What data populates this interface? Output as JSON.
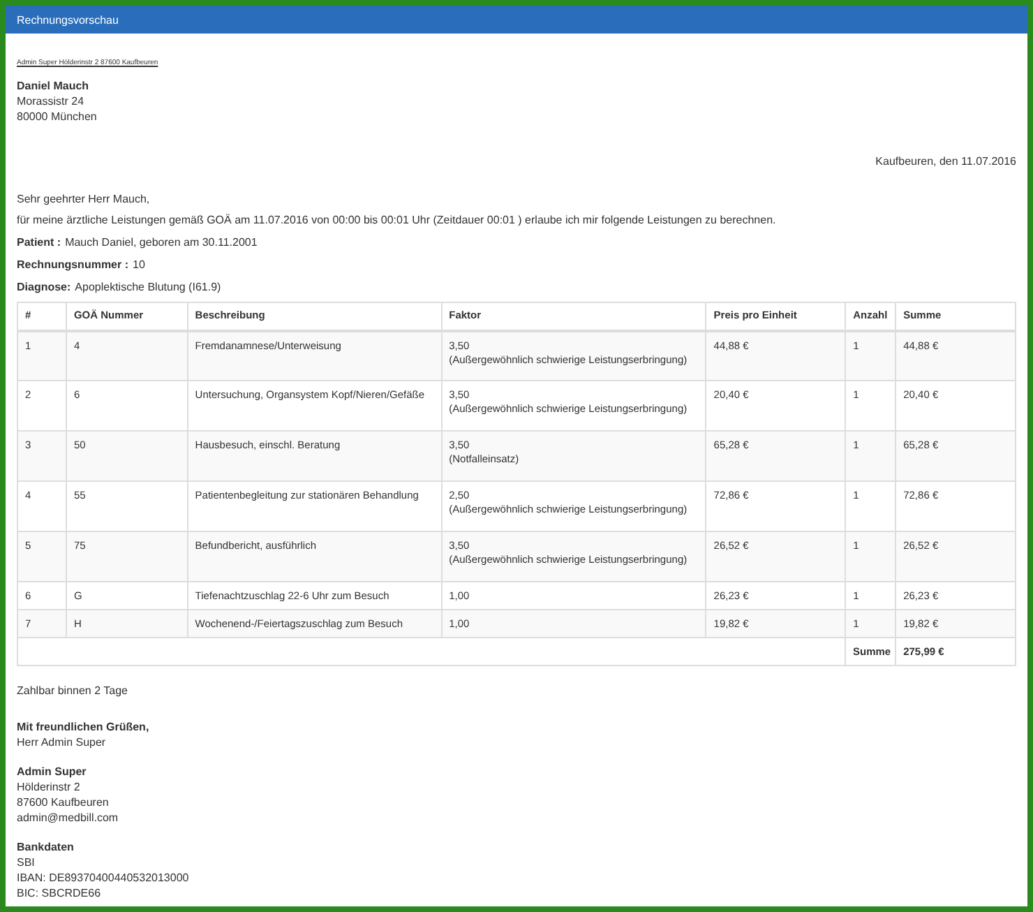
{
  "header": {
    "title": "Rechnungsvorschau"
  },
  "sender_line": "Admin Super Hölderinstr 2 87600 Kaufbeuren",
  "recipient": {
    "name": "Daniel Mauch",
    "lines": [
      "Morassistr 24",
      "80000 München"
    ]
  },
  "date": "Kaufbeuren, den 11.07.2016",
  "greeting": "Sehr geehrter Herr Mauch,",
  "intro": "für meine ärztliche Leistungen gemäß GOÄ am 11.07.2016 von 00:00 bis 00:01 Uhr (Zeitdauer 00:01 ) erlaube ich mir folgende Leistungen zu berechnen.",
  "facts": [
    {
      "label": "Patient :",
      "value": "Mauch Daniel, geboren am 30.11.2001"
    },
    {
      "label": "Rechnungsnummer :",
      "value": "10"
    },
    {
      "label": "Diagnose:",
      "value": "Apoplektische Blutung (I61.9)"
    }
  ],
  "table": {
    "columns": [
      "#",
      "GOÄ Nummer",
      "Beschreibung",
      "Faktor",
      "Preis pro Einheit",
      "Anzahl",
      "Summe"
    ],
    "rows": [
      {
        "cells": [
          "1",
          "4",
          "Fremdanamnese/Unterweisung",
          "3,50",
          "44,88 €",
          "1",
          "44,88 €"
        ],
        "note": "(Außergewöhnlich schwierige Leistungserbringung)"
      },
      {
        "cells": [
          "2",
          "6",
          "Untersuchung, Organsystem Kopf/Nieren/Gefäße",
          "3,50",
          "20,40 €",
          "1",
          "20,40 €"
        ],
        "note": "(Außergewöhnlich schwierige Leistungserbringung)"
      },
      {
        "cells": [
          "3",
          "50",
          "Hausbesuch, einschl. Beratung",
          "3,50",
          "65,28 €",
          "1",
          "65,28 €"
        ],
        "note": "(Notfalleinsatz)"
      },
      {
        "cells": [
          "4",
          "55",
          "Patientenbegleitung zur stationären Behandlung",
          "2,50",
          "72,86 €",
          "1",
          "72,86 €"
        ],
        "note": "(Außergewöhnlich schwierige Leistungserbringung)"
      },
      {
        "cells": [
          "5",
          "75",
          "Befundbericht, ausführlich",
          "3,50",
          "26,52 €",
          "1",
          "26,52 €"
        ],
        "note": "(Außergewöhnlich schwierige Leistungserbringung)"
      },
      {
        "cells": [
          "6",
          "G",
          "Tiefenachtzuschlag 22-6 Uhr zum Besuch",
          "1,00",
          "26,23 €",
          "1",
          "26,23 €"
        ]
      },
      {
        "cells": [
          "7",
          "H",
          "Wochenend-/Feiertagszuschlag zum Besuch",
          "1,00",
          "19,82 €",
          "1",
          "19,82 €"
        ]
      }
    ],
    "total": {
      "label": "Summe",
      "value": "275,99 €"
    }
  },
  "payment_terms": "Zahlbar binnen 2 Tage",
  "closing": {
    "title": "Mit freundlichen Grüßen,",
    "lines": [
      "Herr Admin Super"
    ]
  },
  "sender": {
    "title": "Admin Super",
    "lines": [
      "Hölderinstr 2",
      "87600 Kaufbeuren",
      "admin@medbill.com"
    ]
  },
  "bank": {
    "title": "Bankdaten",
    "lines": [
      "SBI",
      "IBAN: DE89370400440532013000",
      "BIC: SBCRDE66"
    ]
  }
}
